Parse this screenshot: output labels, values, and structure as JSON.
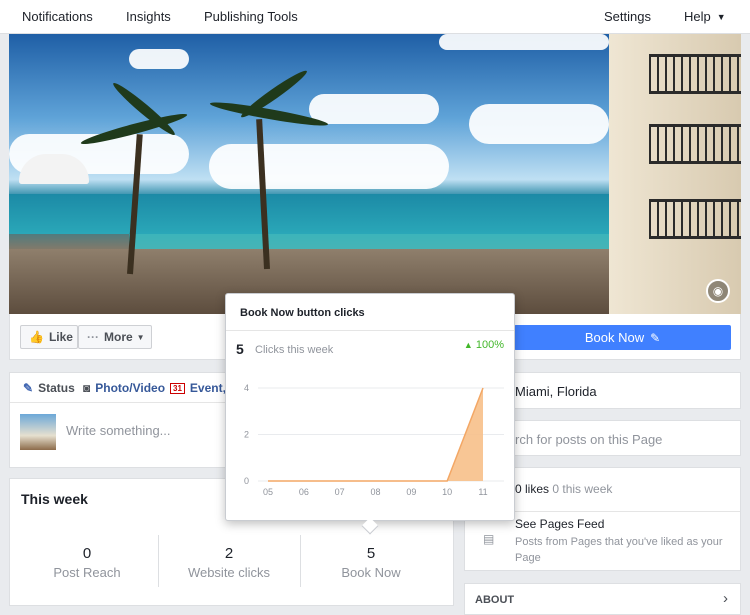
{
  "nav": {
    "items": [
      {
        "label": "Notifications"
      },
      {
        "label": "Insights"
      },
      {
        "label": "Publishing Tools"
      }
    ],
    "right": [
      {
        "label": "Settings"
      },
      {
        "label": "Help"
      }
    ]
  },
  "actions": {
    "like_label": "Like",
    "more_label": "More",
    "book_now_label": "Book Now"
  },
  "composer": {
    "tabs": [
      {
        "label": "Status",
        "icon": "pencil-icon"
      },
      {
        "label": "Photo/Video",
        "icon": "camera-icon"
      },
      {
        "label": "Event, I",
        "icon": "calendar-icon"
      }
    ],
    "calendar_day": "31",
    "placeholder": "Write something..."
  },
  "this_week": {
    "title": "This week",
    "stats": [
      {
        "value": "0",
        "label": "Post Reach"
      },
      {
        "value": "2",
        "label": "Website clicks"
      },
      {
        "value": "5",
        "label": "Book Now"
      }
    ]
  },
  "right": {
    "location": "Miami, Florida",
    "search_placeholder": "rch for posts on this Page",
    "likes": "0 likes",
    "likes_week": "0 this week",
    "feed_title": "See Pages Feed",
    "feed_desc": "Posts from Pages that you've liked as your Page",
    "about": "ABOUT"
  },
  "popup": {
    "title": "Book Now button clicks",
    "big_number": "5",
    "subtitle": "Clicks this week",
    "change": "100%",
    "colors": {
      "area": "#f7c08a",
      "area_stroke": "#f3a765",
      "change": "#42b72a"
    }
  },
  "chart_data": {
    "type": "area",
    "categories": [
      "05",
      "06",
      "07",
      "08",
      "09",
      "10",
      "11"
    ],
    "values": [
      0,
      0,
      0,
      0,
      0,
      0,
      4
    ],
    "ylim": [
      0,
      4
    ],
    "yticks": [
      0,
      2,
      4
    ],
    "grid": true,
    "title": "",
    "xlabel": "",
    "ylabel": ""
  }
}
